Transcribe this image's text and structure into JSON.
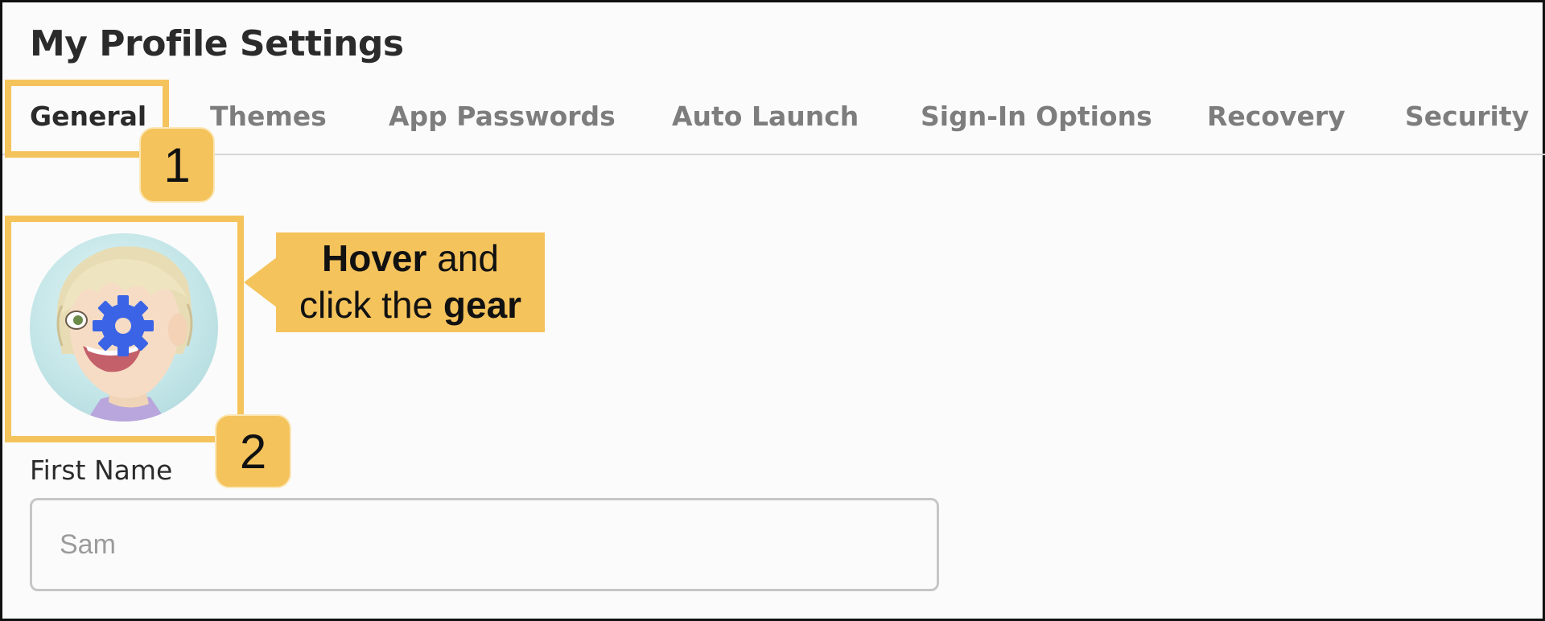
{
  "page": {
    "title": "My Profile Settings"
  },
  "tabs": [
    {
      "label": "General",
      "active": true
    },
    {
      "label": "Themes",
      "active": false
    },
    {
      "label": "App Passwords",
      "active": false
    },
    {
      "label": "Auto Launch",
      "active": false
    },
    {
      "label": "Sign-In Options",
      "active": false
    },
    {
      "label": "Recovery",
      "active": false
    },
    {
      "label": "Security",
      "active": false
    }
  ],
  "annotations": {
    "step1": "1",
    "step2": "2",
    "callout": {
      "bold1": "Hover",
      "text1": " and",
      "text2": "click the ",
      "bold2": "gear"
    }
  },
  "avatar": {
    "icon": "gear-icon",
    "gear_color": "#3b63e6"
  },
  "form": {
    "first_name_label": "First Name",
    "first_name_value": "Sam"
  },
  "colors": {
    "highlight": "#f5c35c",
    "active_tab": "#2b2b2b",
    "inactive_tab": "#7d7d7d"
  }
}
